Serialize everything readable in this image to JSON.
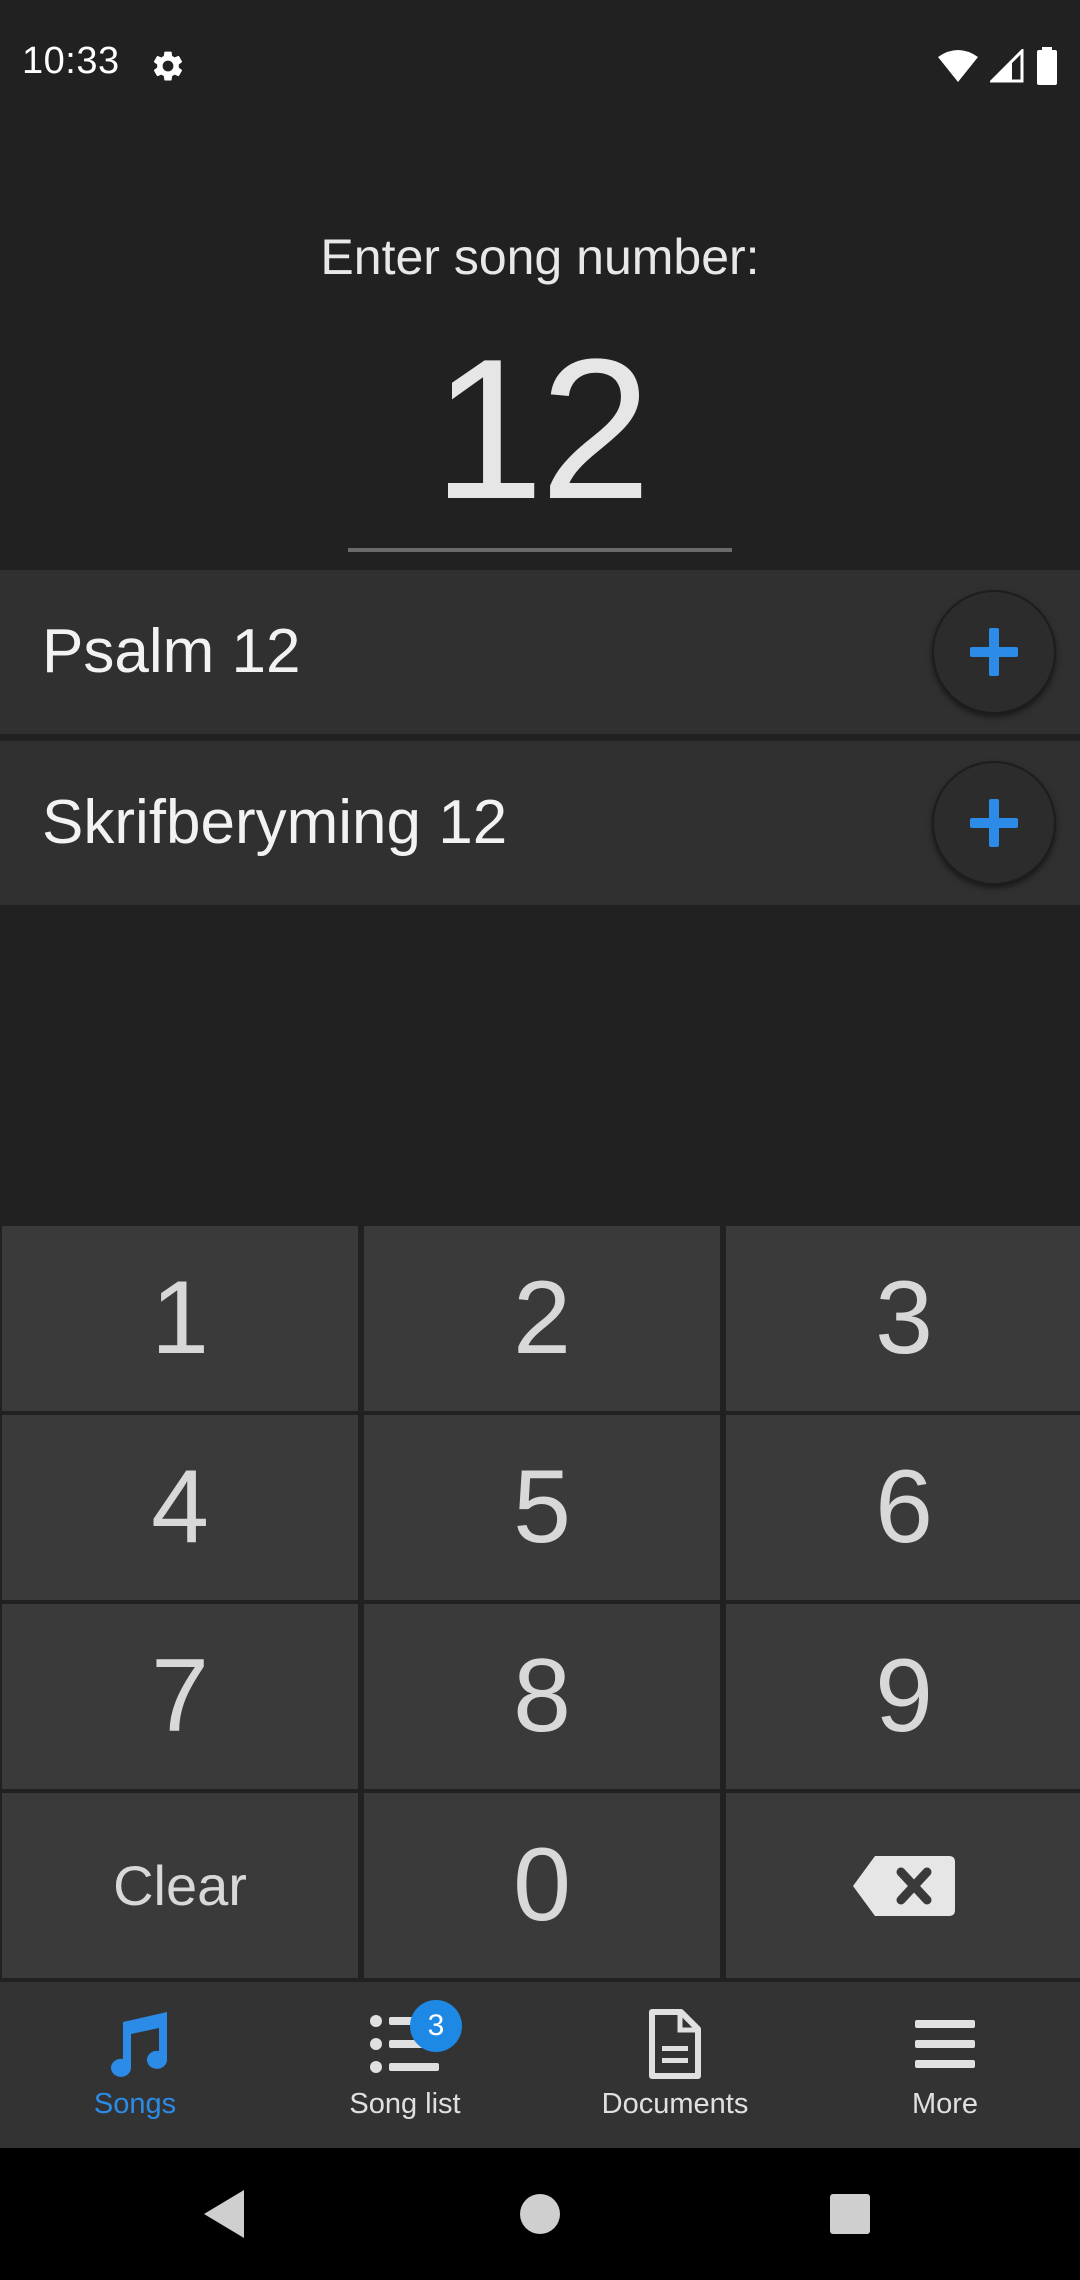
{
  "status_bar": {
    "time": "10:33"
  },
  "entry": {
    "prompt": "Enter song number:",
    "value": "12"
  },
  "results": [
    {
      "label": "Psalm 12"
    },
    {
      "label": "Skrifberyming 12"
    }
  ],
  "keypad": {
    "keys": [
      "1",
      "2",
      "3",
      "4",
      "5",
      "6",
      "7",
      "8",
      "9",
      "Clear",
      "0"
    ]
  },
  "bottom_nav": {
    "items": [
      {
        "label": "Songs",
        "icon": "music-note-icon",
        "active": true
      },
      {
        "label": "Song list",
        "icon": "list-icon",
        "badge": "3"
      },
      {
        "label": "Documents",
        "icon": "document-icon"
      },
      {
        "label": "More",
        "icon": "menu-icon"
      }
    ]
  },
  "colors": {
    "accent": "#2b8be6",
    "background": "#212121",
    "row": "#303030",
    "key": "#3a3a3a"
  }
}
